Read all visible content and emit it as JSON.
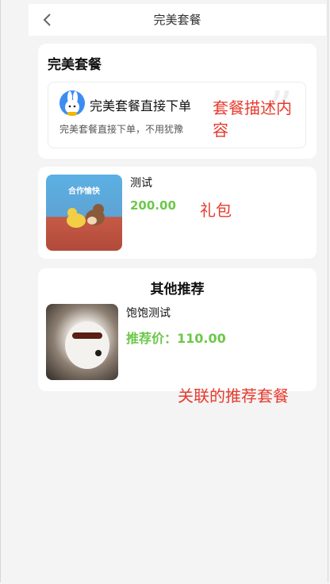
{
  "nav": {
    "back_icon": "chevron-left-icon",
    "title": "完美套餐"
  },
  "package": {
    "title": "完美套餐",
    "name": "完美套餐直接下单",
    "desc": "完美套餐直接下单，不用犹豫",
    "annotation_line1": "套餐描述内",
    "annotation_line2": "容"
  },
  "gift": {
    "image_caption": "合作愉快",
    "name": "测试",
    "price": "200.00",
    "annotation": "礼包"
  },
  "recommend": {
    "section_title": "其他推荐",
    "name": "饱饱测试",
    "price": "推荐价：110.00",
    "annotation": "关联的推荐套餐"
  },
  "colors": {
    "accent_green": "#6cc84a",
    "annotation_red": "#e73a2d"
  }
}
